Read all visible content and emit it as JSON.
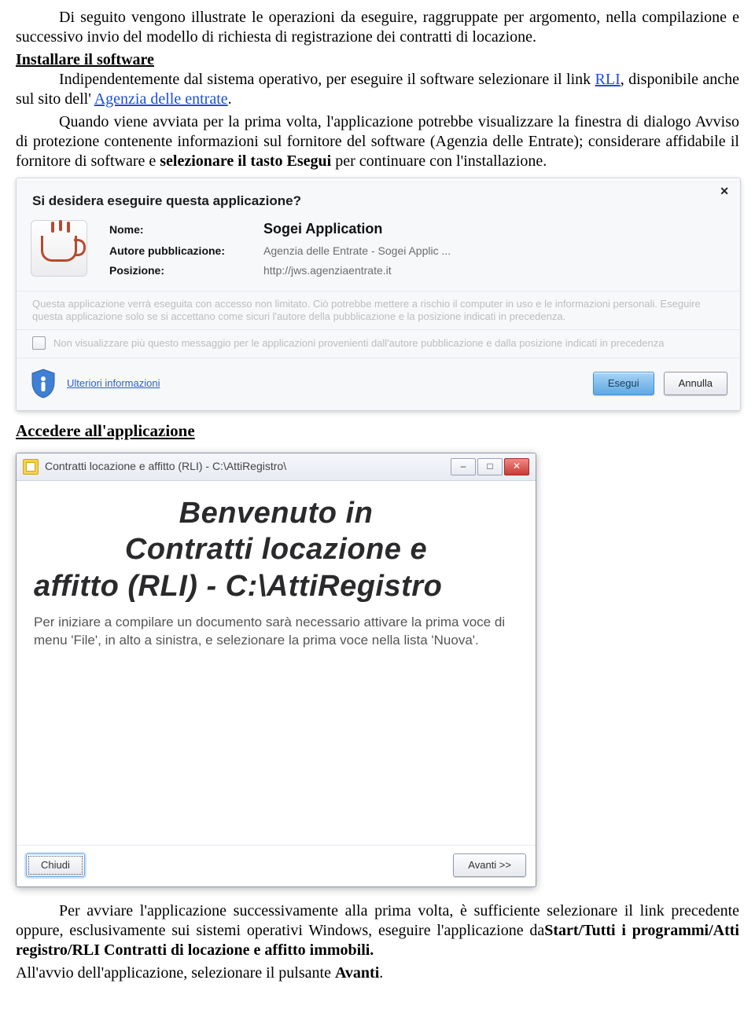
{
  "intro": {
    "p1": "Di seguito vengono illustrate le operazioni da eseguire, raggruppate per argomento, nella compilazione e successivo invio del modello di richiesta di registrazione dei contratti di locazione.",
    "h_install": "Installare il software",
    "p2a": "Indipendentemente dal sistema operativo, per eseguire il software selezionare il link ",
    "link_rli": "RLI",
    "p2b": ", disponibile anche sul sito dell' ",
    "link_ade": "Agenzia delle entrate",
    "p2c": ".",
    "p3a": "Quando viene avviata per la prima volta, l'applicazione potrebbe visualizzare la finestra di dialogo Avviso di protezione contenente informazioni sul fornitore del software (Agenzia delle Entrate); considerare affidabile il fornitore di software e ",
    "p3b_bold": "selezionare il tasto Esegui",
    "p3c": " per continuare con l'installazione."
  },
  "dlg1": {
    "question": "Si desidera eseguire questa applicazione?",
    "lbl_name": "Nome:",
    "val_name": "Sogei Application",
    "lbl_pub": "Autore pubblicazione:",
    "val_pub": "Agenzia delle Entrate - Sogei Applic ...",
    "lbl_pos": "Posizione:",
    "val_pos": "http://jws.agenziaentrate.it",
    "risk": "Questa applicazione verrà eseguita con accesso non limitato. Ciò potrebbe mettere a rischio il computer in uso e le informazioni personali. Eseguire questa applicazione solo se si accettano come sicuri l'autore della pubblicazione e la posizione indicati in precedenza.",
    "chk": "Non visualizzare più questo messaggio per le applicazioni provenienti dall'autore pubblicazione e dalla posizione indicati in precedenza",
    "more": "Ulteriori informazioni",
    "btn_run": "Esegui",
    "btn_cancel": "Annulla",
    "close": "✕"
  },
  "h_access": "Accedere all'applicazione",
  "dlg2": {
    "title": "Contratti locazione e affitto (RLI) - C:\\AttiRegistro\\",
    "min": "–",
    "max": "□",
    "close": "✕",
    "big1": "Benvenuto in",
    "big2": "Contratti locazione e",
    "big3": "affitto (RLI) - C:\\AttiRegistro",
    "desc": "Per iniziare a compilare un documento sarà necessario attivare la prima voce di menu 'File', in alto a sinistra, e selezionare la prima voce nella lista 'Nuova'.",
    "btn_close": "Chiudi",
    "btn_next": "Avanti >>"
  },
  "outro": {
    "p1": "Per avviare l'applicazione successivamente alla prima volta, è sufficiente selezionare il link precedente oppure, esclusivamente sui sistemi operativi Windows, eseguire l'applicazione da",
    "p1_bold": "Start/Tutti i programmi/Atti registro/RLI Contratti di locazione e affitto immobili.",
    "p2a": "All'avvio dell'applicazione, selezionare il pulsante ",
    "p2b_bold": "Avanti",
    "p2c": "."
  }
}
